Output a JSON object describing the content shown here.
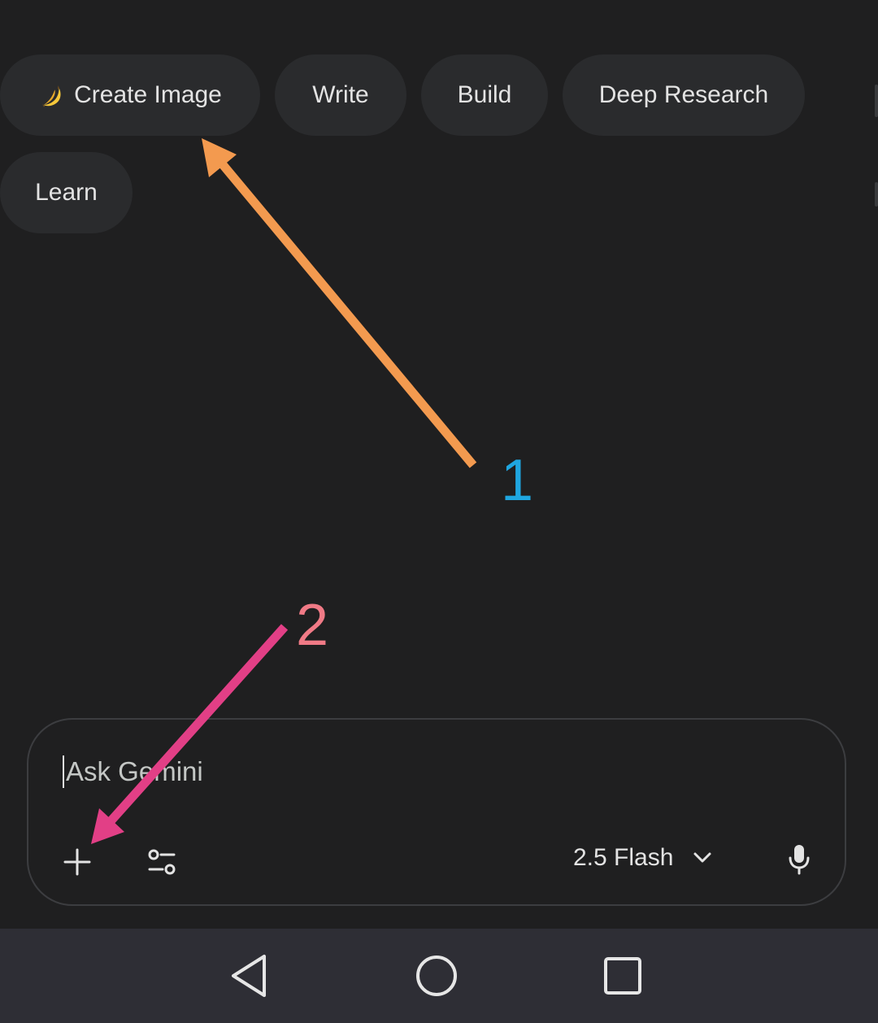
{
  "chips": {
    "create_image": {
      "label": "Create Image",
      "emoji": "banana-icon"
    },
    "write": "Write",
    "build": "Build",
    "deep_research": "Deep Research",
    "learn": "Learn"
  },
  "prompt": {
    "placeholder": "Ask Gemini",
    "model": "2.5 Flash"
  },
  "icons": {
    "plus": "plus-icon",
    "tools": "tune-icon",
    "model_toggle": "chevron-down-icon",
    "mic": "mic-icon",
    "nav_back": "back-triangle-icon",
    "nav_home": "home-circle-icon",
    "nav_recents": "recents-square-icon"
  },
  "annotations": {
    "one": {
      "number": "1",
      "arrow_color": "#f39a4f",
      "number_color": "#1fa6e0"
    },
    "two": {
      "number": "2",
      "arrow_color": "#e23f86",
      "number_color": "#f07a86"
    }
  },
  "colors": {
    "background": "#1f1f20",
    "chip_background": "#2a2b2d",
    "nav_bar": "#2e2e35"
  }
}
